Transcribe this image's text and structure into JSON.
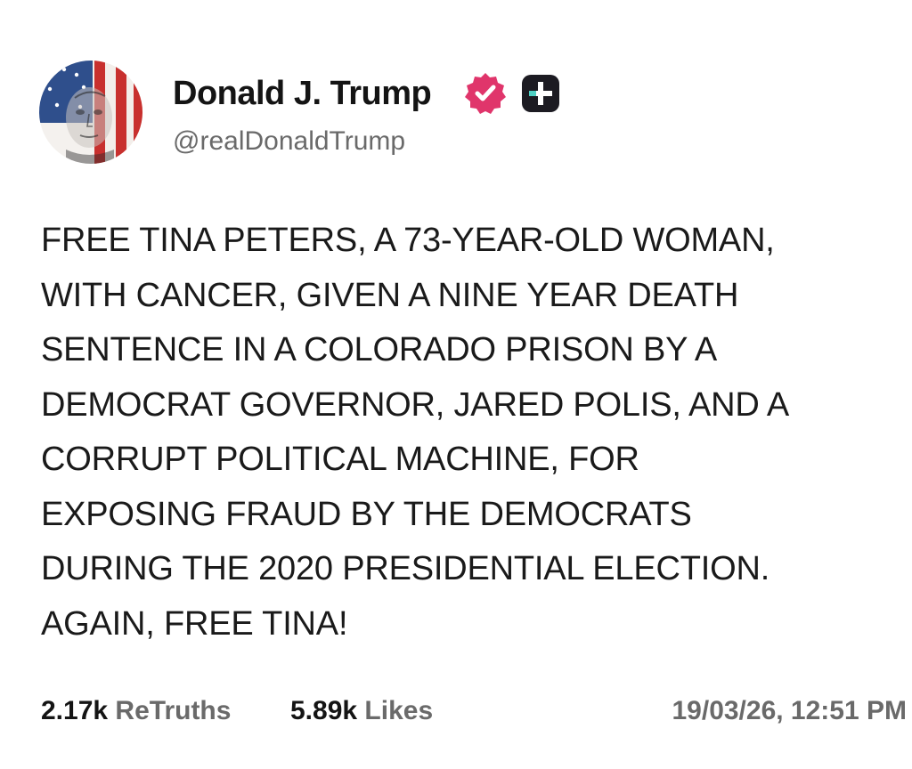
{
  "author": {
    "display_name": "Donald J. Trump",
    "handle": "@realDonaldTrump",
    "verified_icon": "verified-badge-icon",
    "plus_icon": "plus-badge-icon",
    "badge_color": "#e0356b",
    "plus_badge_color": "#1c1b22"
  },
  "post": {
    "lines": [
      "FREE TINA PETERS, A 73-YEAR-OLD WOMAN,",
      "WITH CANCER, GIVEN A NINE YEAR DEATH",
      "SENTENCE IN A COLORADO PRISON BY A",
      "DEMOCRAT GOVERNOR, JARED POLIS, AND A",
      "CORRUPT POLITICAL MACHINE, FOR",
      "EXPOSING FRAUD BY THE DEMOCRATS",
      "DURING THE 2020 PRESIDENTIAL ELECTION.",
      "AGAIN, FREE TINA!"
    ]
  },
  "stats": {
    "retruths_count": "2.17k",
    "retruths_label": "ReTruths",
    "likes_count": "5.89k",
    "likes_label": "Likes",
    "timestamp": "19/03/26, 12:51 PM"
  }
}
